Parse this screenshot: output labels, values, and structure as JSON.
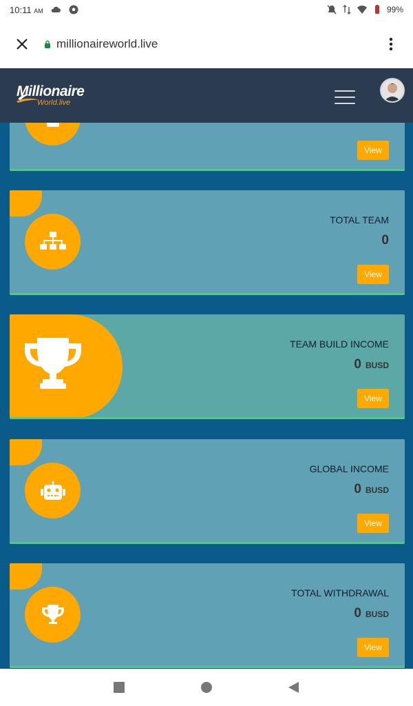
{
  "status": {
    "time": "10:11",
    "ampm": "AM",
    "battery": "99%"
  },
  "browser": {
    "url": "millionaireworld.live"
  },
  "header": {
    "logo_main": "Millionaire",
    "logo_sub": "World.live"
  },
  "cards": [
    {
      "title": "",
      "value": "",
      "unit": "",
      "view_label": "View"
    },
    {
      "title": "TOTAL TEAM",
      "value": "0",
      "unit": "",
      "view_label": "View"
    },
    {
      "title": "TEAM BUILD INCOME",
      "value": "0",
      "unit": "BUSD",
      "view_label": "View"
    },
    {
      "title": "GLOBAL INCOME",
      "value": "0",
      "unit": "BUSD",
      "view_label": "View"
    },
    {
      "title": "TOTAL WITHDRAWAL",
      "value": "0",
      "unit": "BUSD",
      "view_label": "View"
    }
  ],
  "colors": {
    "header_bg": "#2b3c51",
    "content_bg": "#0a5a8a",
    "card_bg": "#61a1b5",
    "accent": "#ffa800",
    "card_border": "#52c885"
  }
}
